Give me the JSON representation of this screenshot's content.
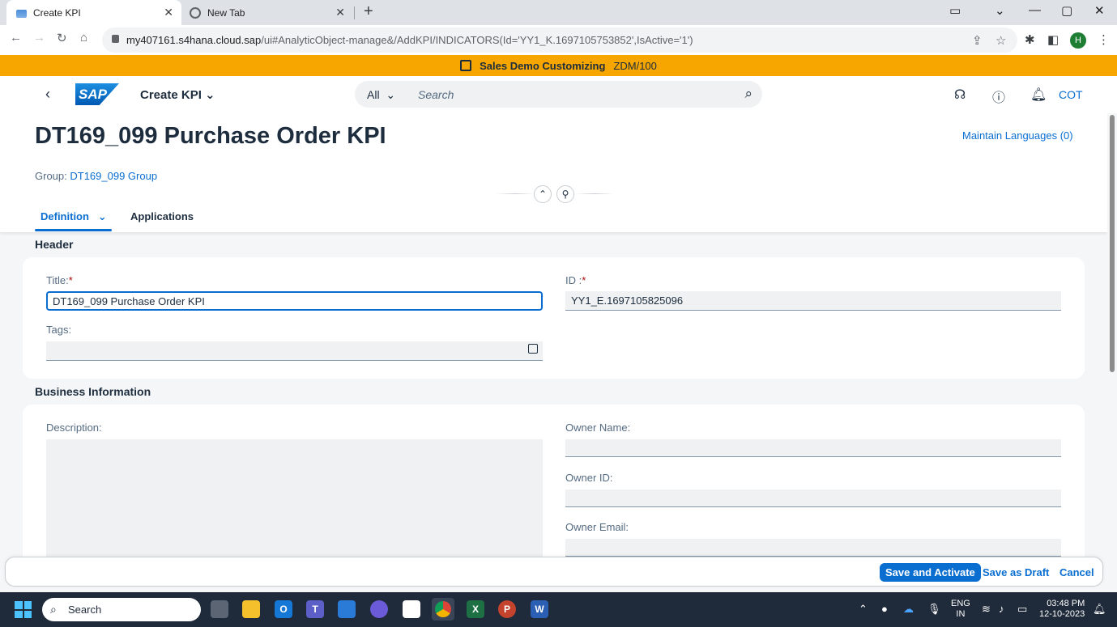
{
  "browser": {
    "tabs": [
      {
        "label": "Create KPI",
        "active": true
      },
      {
        "label": "New Tab",
        "active": false
      }
    ],
    "url_host": "my407161.s4hana.cloud.sap",
    "url_path": "/ui#AnalyticObject-manage&/AddKPI/INDICATORS(Id='YY1_K.1697105753852',IsActive='1')",
    "profile_initial": "H"
  },
  "banner": {
    "system": "Sales Demo Customizing",
    "client": "ZDM/100"
  },
  "shell": {
    "app_title": "Create KPI",
    "search_scope": "All",
    "search_placeholder": "Search",
    "user": "COT"
  },
  "header": {
    "title": "DT169_099 Purchase Order KPI",
    "maintain_languages": "Maintain Languages (0)",
    "group_label": "Group:",
    "group_value": "DT169_099 Group",
    "tabs": [
      "Definition",
      "Applications"
    ]
  },
  "sections": {
    "header": {
      "title": "Header",
      "title_label": "Title:",
      "title_value": "DT169_099 Purchase Order KPI",
      "id_label": "ID :",
      "id_value": "YY1_E.1697105825096",
      "tags_label": "Tags:",
      "tags_value": ""
    },
    "business": {
      "title": "Business Information",
      "description_label": "Description:",
      "owner_name_label": "Owner Name:",
      "owner_id_label": "Owner ID:",
      "owner_email_label": "Owner Email:"
    }
  },
  "footer": {
    "save_activate": "Save and Activate",
    "save_draft": "Save as Draft",
    "cancel": "Cancel"
  },
  "taskbar": {
    "search_label": "Search",
    "lang_line1": "ENG",
    "lang_line2": "IN",
    "time": "03:48 PM",
    "date": "12-10-2023"
  },
  "colors": {
    "accent": "#0a6ed1",
    "banner": "#f7a600",
    "required": "#aa0808"
  }
}
